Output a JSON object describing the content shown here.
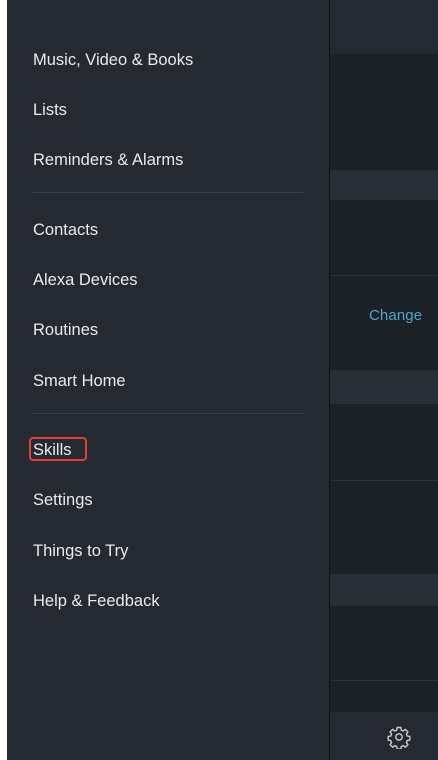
{
  "drawer": {
    "menu_items": [
      {
        "label": "Music, Video & Books"
      },
      {
        "label": "Lists"
      },
      {
        "label": "Reminders & Alarms"
      },
      {
        "label": "Contacts"
      },
      {
        "label": "Alexa Devices"
      },
      {
        "label": "Routines"
      },
      {
        "label": "Smart Home"
      },
      {
        "label": "Skills"
      },
      {
        "label": "Settings"
      },
      {
        "label": "Things to Try"
      },
      {
        "label": "Help & Feedback"
      }
    ],
    "highlighted_item": "Skills",
    "highlight_color": "#e0403a"
  },
  "background_app": {
    "change_link": "Change",
    "settings_icon": "gear-icon",
    "link_color": "#4fa7c9"
  }
}
